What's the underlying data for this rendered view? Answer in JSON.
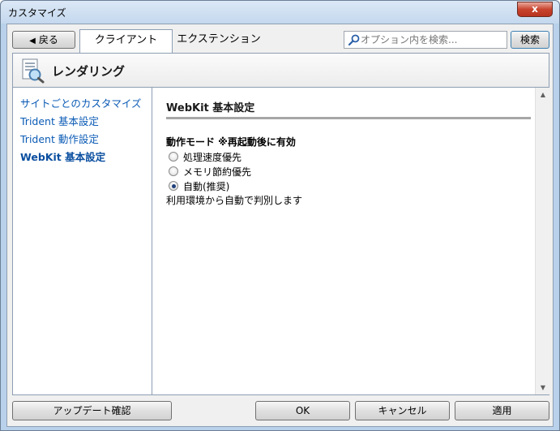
{
  "window": {
    "title": "カスタマイズ",
    "close_glyph": "x"
  },
  "toolbar": {
    "back_label": "戻る",
    "tabs": [
      {
        "label": "クライアント",
        "active": true
      },
      {
        "label": "エクステンション",
        "active": false
      }
    ],
    "search_placeholder": "オプション内を検索...",
    "search_button": "検索"
  },
  "header": {
    "title": "レンダリング",
    "icon": "page-magnifier-icon"
  },
  "sidebar": {
    "items": [
      {
        "label": "サイトごとのカスタマイズ",
        "active": false
      },
      {
        "label": "Trident 基本設定",
        "active": false
      },
      {
        "label": "Trident 動作設定",
        "active": false
      },
      {
        "label": "WebKit 基本設定",
        "active": true
      }
    ]
  },
  "content": {
    "title": "WebKit 基本設定",
    "mode_label": "動作モード ※再起動後に有効",
    "options": [
      {
        "label": "処理速度優先",
        "checked": false
      },
      {
        "label": "メモリ節約優先",
        "checked": false
      },
      {
        "label": "自動(推奨)",
        "checked": true
      }
    ],
    "note": "利用環境から自動で判別します"
  },
  "footer": {
    "update_label": "アップデート確認",
    "ok_label": "OK",
    "cancel_label": "キャンセル",
    "apply_label": "適用"
  },
  "colors": {
    "link": "#0b5bb5",
    "frame": "#b9d1ea",
    "close": "#c8442e"
  }
}
